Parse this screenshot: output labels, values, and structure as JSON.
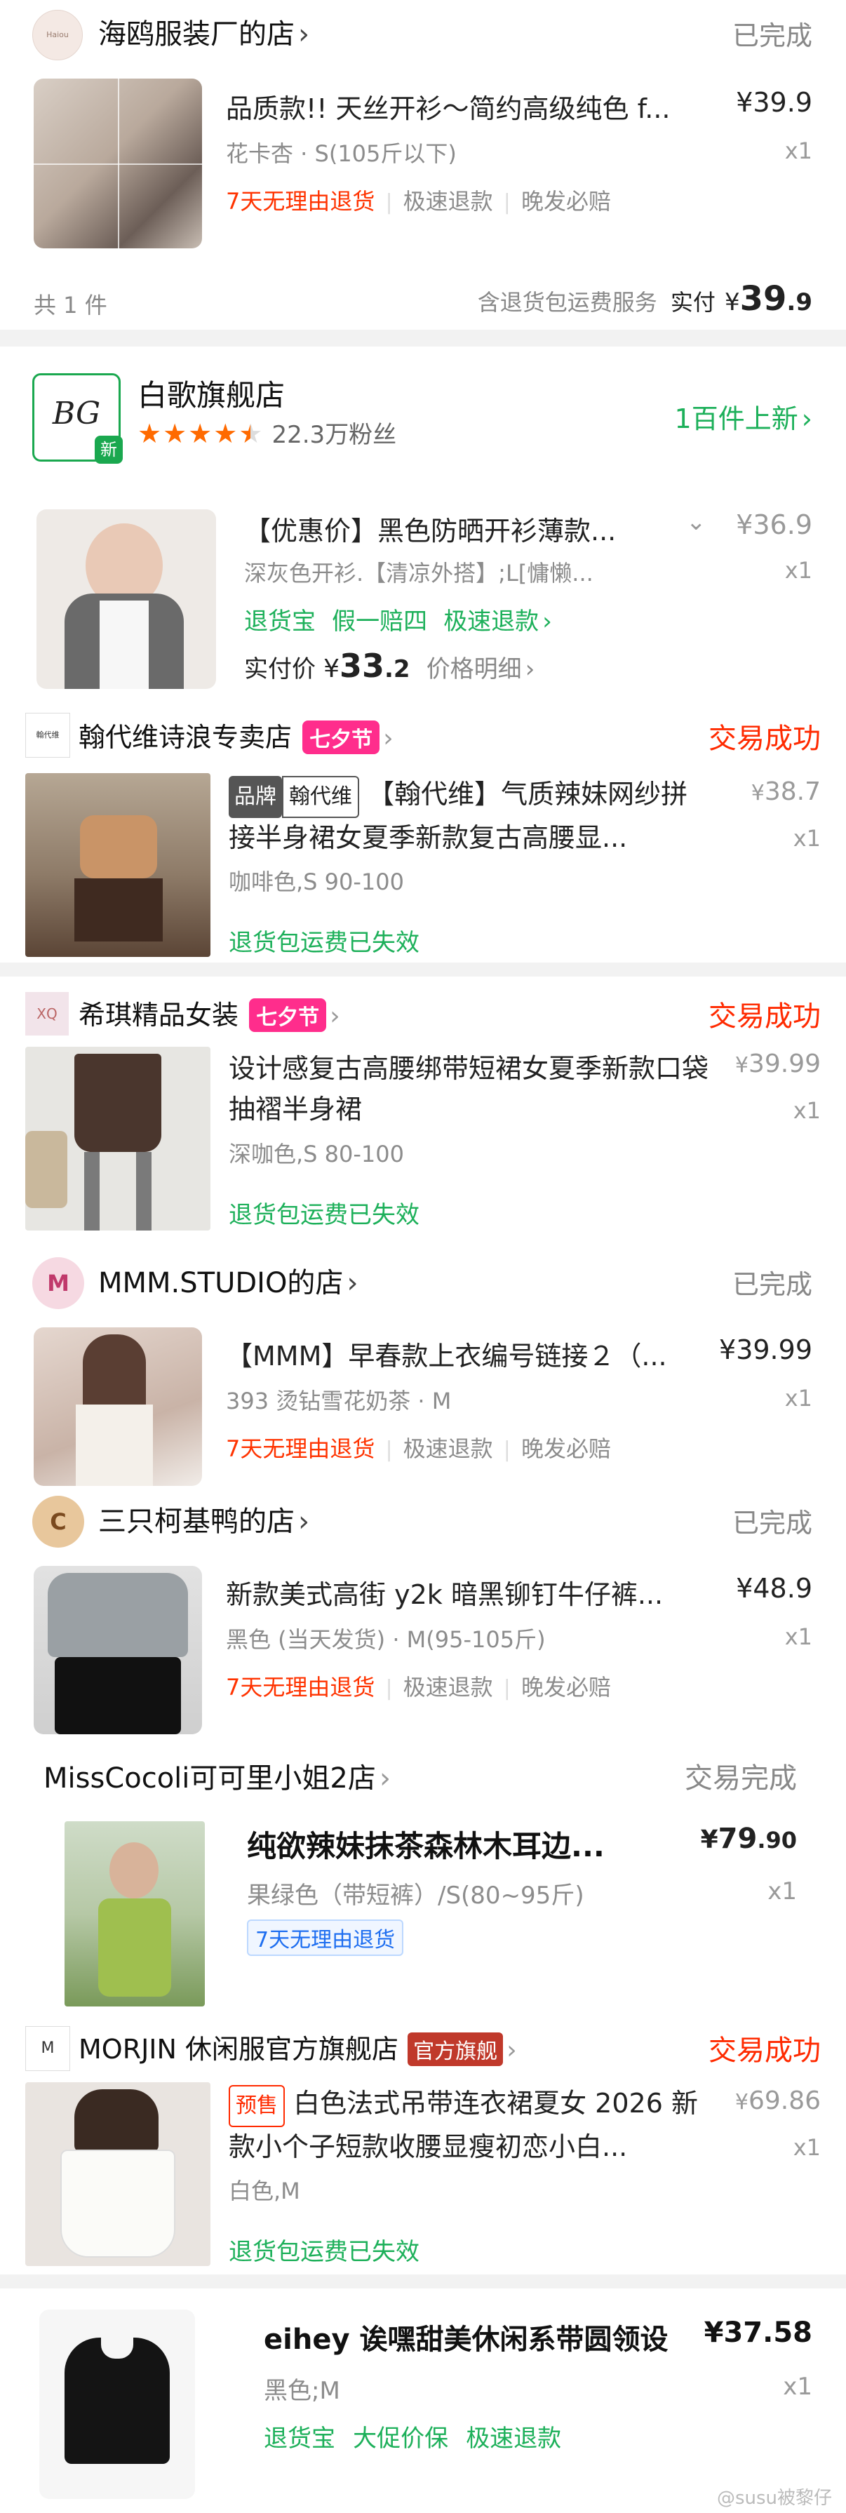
{
  "orders": [
    {
      "shop": "海鸥服装厂的店",
      "logo_text": "Haiou",
      "status": "已完成",
      "title": "品质款!! 天丝开衫～简约高级纯色 f...",
      "price": "¥39.9",
      "spec": "花卡杏 · S(105斤以下)",
      "qty": "x1",
      "services": [
        "7天无理由退货",
        "极速退款",
        "晚发必赔"
      ],
      "summary_count": "共 1 件",
      "summary_note": "含退货包运费服务",
      "paid_label": "实付",
      "paid_symbol": "¥",
      "paid_int": "39",
      "paid_dec": ".9"
    },
    {
      "shop": "白歌旗舰店",
      "logo_text": "BG",
      "logo_badge": "新",
      "rating_stars": 4.5,
      "fans": "22.3万粉丝",
      "new_items": "1百件上新",
      "title": "【优惠价】黑色防晒开衫薄款...",
      "price": "¥36.9",
      "spec": "深灰色开衫.【清凉外搭】;L[慵懒...",
      "qty": "x1",
      "services": [
        "退货宝",
        "假一赔四",
        "极速退款"
      ],
      "paid_label": "实付价",
      "paid_symbol": "¥",
      "paid_int": "33",
      "paid_dec": ".2",
      "price_detail": "价格明细"
    },
    {
      "shop": "翰代维诗浪专卖店",
      "logo_text": "翰代维",
      "festival": "七夕节",
      "status": "交易成功",
      "brand_tag": "品牌",
      "brand_name": "翰代维",
      "title": "【翰代维】气质辣妹网纱拼接半身裙女夏季新款复古高腰显...",
      "price_symbol": "¥",
      "price": "38.7",
      "spec": "咖啡色,S 90-100",
      "qty": "x1",
      "note": "退货包运费已失效"
    },
    {
      "shop": "希琪精品女装",
      "logo_text": "XQ",
      "festival": "七夕节",
      "status": "交易成功",
      "title": "设计感复古高腰绑带短裙女夏季新款口袋抽褶半身裙",
      "price_symbol": "¥",
      "price": "39.99",
      "spec": "深咖色,S 80-100",
      "qty": "x1",
      "note": "退货包运费已失效"
    },
    {
      "shop": "MMM.STUDIO的店",
      "logo_text": "M",
      "status": "已完成",
      "title": "【MMM】早春款上衣编号链接２（...",
      "price": "¥39.99",
      "spec": "393 烫钻雪花奶茶 · M",
      "qty": "x1",
      "services": [
        "7天无理由退货",
        "极速退款",
        "晚发必赔"
      ]
    },
    {
      "shop": "三只柯基鸭的店",
      "logo_text": "C",
      "status": "已完成",
      "title": "新款美式高街 y2k 暗黑铆钉牛仔裤...",
      "price": "¥48.9",
      "spec": "黑色 (当天发货) · M(95-105斤)",
      "qty": "x1",
      "services": [
        "7天无理由退货",
        "极速退款",
        "晚发必赔"
      ]
    },
    {
      "shop": "MissCocoli可可里小姐2店",
      "status": "交易完成",
      "title": "纯欲辣妹抹茶森林木耳边...",
      "price_symbol": "¥",
      "price_int": "79",
      "price_dec": ".90",
      "spec": "果绿色（带短裤）/S(80~95斤)",
      "qty": "x1",
      "services": [
        "7天无理由退货"
      ]
    },
    {
      "shop": "MORJIN 休闲服官方旗舰店",
      "logo_text": "M",
      "official": "官方旗舰",
      "status": "交易成功",
      "presale": "预售",
      "title": "白色法式吊带连衣裙夏女 2026 新款小个子短款收腰显瘦初恋小白...",
      "price_symbol": "¥",
      "price": "69.86",
      "spec": "白色,M",
      "qty": "x1",
      "note": "退货包运费已失效"
    },
    {
      "title": "eihey 诶嘿甜美休闲系带圆领设",
      "price": "¥37.58",
      "spec": "黑色;M",
      "qty": "x1",
      "services": [
        "退货宝",
        "大促价保",
        "极速退款"
      ]
    }
  ],
  "watermark": "@susu被黎仔",
  "colors": {
    "red": "#ff2a00",
    "green": "#1db05a",
    "pink": "#ff2d8c",
    "gray": "#8c8c8c"
  }
}
